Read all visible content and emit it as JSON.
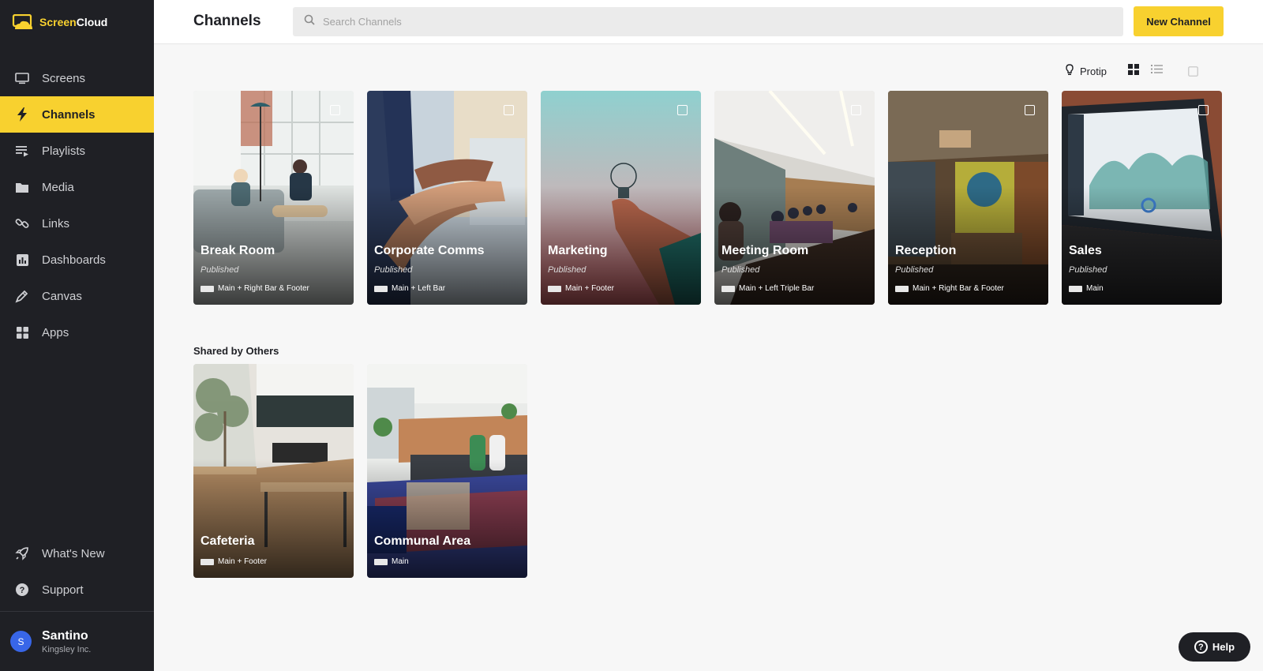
{
  "brand": {
    "name_part1": "Screen",
    "name_part2": "Cloud"
  },
  "sidebar": {
    "items": [
      {
        "label": "Screens",
        "icon": "monitor-icon"
      },
      {
        "label": "Channels",
        "icon": "lightning-icon",
        "active": true
      },
      {
        "label": "Playlists",
        "icon": "playlist-icon"
      },
      {
        "label": "Media",
        "icon": "folder-icon"
      },
      {
        "label": "Links",
        "icon": "link-icon"
      },
      {
        "label": "Dashboards",
        "icon": "bar-chart-icon"
      },
      {
        "label": "Canvas",
        "icon": "pen-icon"
      },
      {
        "label": "Apps",
        "icon": "grid-apps-icon"
      }
    ],
    "bottom_items": [
      {
        "label": "What's New",
        "icon": "rocket-icon"
      },
      {
        "label": "Support",
        "icon": "question-icon"
      }
    ]
  },
  "user": {
    "initial": "S",
    "name": "Santino",
    "org": "Kingsley Inc."
  },
  "header": {
    "title": "Channels",
    "search_placeholder": "Search Channels",
    "new_button": "New Channel"
  },
  "toolbar": {
    "protip": "Protip"
  },
  "channels": [
    {
      "title": "Break Room",
      "status": "Published",
      "layout": "Main + Right Bar & Footer"
    },
    {
      "title": "Corporate Comms",
      "status": "Published",
      "layout": "Main + Left Bar"
    },
    {
      "title": "Marketing",
      "status": "Published",
      "layout": "Main + Footer"
    },
    {
      "title": "Meeting Room",
      "status": "Published",
      "layout": "Main + Left Triple Bar"
    },
    {
      "title": "Reception",
      "status": "Published",
      "layout": "Main + Right Bar & Footer"
    },
    {
      "title": "Sales",
      "status": "Published",
      "layout": "Main"
    }
  ],
  "shared": {
    "heading": "Shared by Others",
    "channels": [
      {
        "title": "Cafeteria",
        "layout": "Main + Footer"
      },
      {
        "title": "Communal Area",
        "layout": "Main"
      }
    ]
  },
  "help": {
    "label": "Help"
  },
  "colors": {
    "accent": "#f8d12f",
    "sidebar_bg": "#1f2025",
    "avatar": "#3866e8"
  }
}
